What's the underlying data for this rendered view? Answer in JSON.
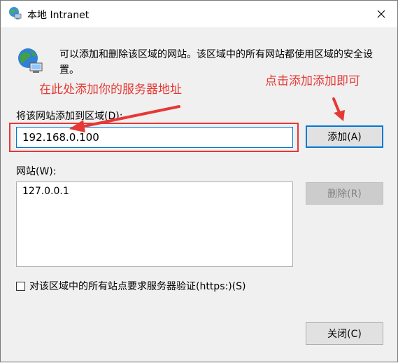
{
  "window": {
    "title": "本地 Intranet",
    "description": "可以添加和删除该区域的网站。该区域中的所有网站都使用区域的安全设置。"
  },
  "annotations": {
    "left": "在此处添加你的服务器地址",
    "right": "点击添加添加即可"
  },
  "add_section": {
    "label": "将该网站添加到区域(D):",
    "input_value": "192.168.0.100",
    "add_button": "添加(A)"
  },
  "sites_section": {
    "label": "网站(W):",
    "items": [
      "127.0.0.1"
    ],
    "remove_button": "删除(R)"
  },
  "https_option": {
    "label": "对该区域中的所有站点要求服务器验证(https:)(S)",
    "checked": false
  },
  "footer": {
    "close_button": "关闭(C)"
  },
  "colors": {
    "annotation": "#e53935",
    "focus": "#0078d7"
  },
  "icons": [
    "globe-network-icon",
    "close-icon",
    "arrow-icon"
  ]
}
